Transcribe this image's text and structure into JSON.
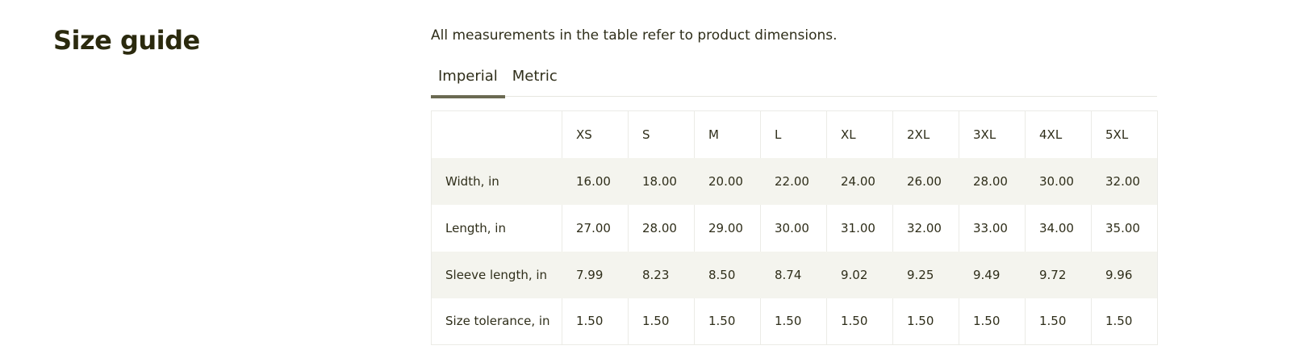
{
  "page": {
    "title": "Size guide",
    "intro": "All measurements in the table refer to product dimensions."
  },
  "tabs": [
    {
      "label": "Imperial",
      "active": true
    },
    {
      "label": "Metric",
      "active": false
    }
  ],
  "table": {
    "sizes": [
      "XS",
      "S",
      "M",
      "L",
      "XL",
      "2XL",
      "3XL",
      "4XL",
      "5XL"
    ],
    "rows": [
      {
        "label": "Width, in",
        "values": [
          "16.00",
          "18.00",
          "20.00",
          "22.00",
          "24.00",
          "26.00",
          "28.00",
          "30.00",
          "32.00"
        ]
      },
      {
        "label": "Length, in",
        "values": [
          "27.00",
          "28.00",
          "29.00",
          "30.00",
          "31.00",
          "32.00",
          "33.00",
          "34.00",
          "35.00"
        ]
      },
      {
        "label": "Sleeve length, in",
        "values": [
          "7.99",
          "8.23",
          "8.50",
          "8.74",
          "9.02",
          "9.25",
          "9.49",
          "9.72",
          "9.96"
        ]
      },
      {
        "label": "Size tolerance, in",
        "values": [
          "1.50",
          "1.50",
          "1.50",
          "1.50",
          "1.50",
          "1.50",
          "1.50",
          "1.50",
          "1.50"
        ]
      }
    ]
  },
  "colors": {
    "text": "#2b2a12",
    "accent_underline": "#6b6a52",
    "row_stripe": "#f4f4ee",
    "border": "#ebebe6"
  }
}
